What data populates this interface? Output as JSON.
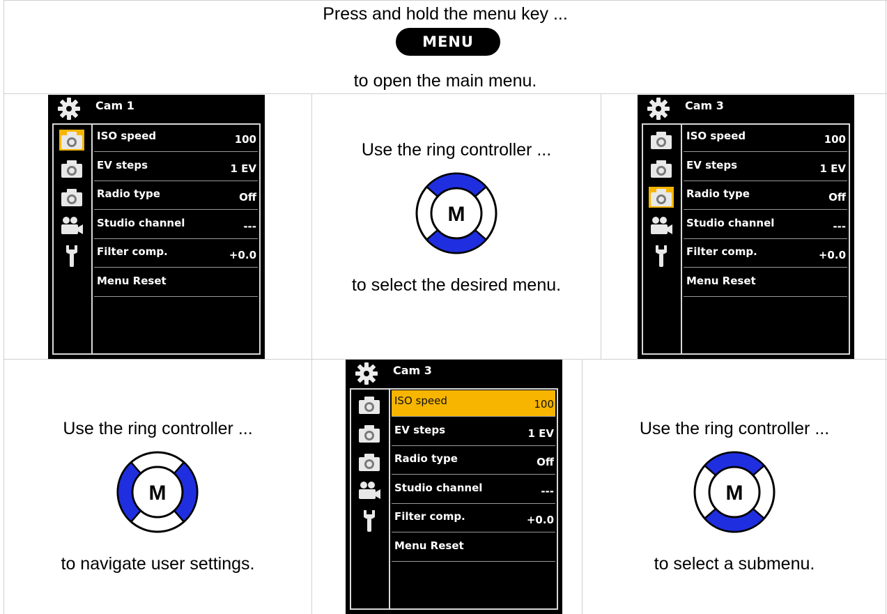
{
  "top": {
    "line1": "Press and hold the menu key ...",
    "key_label": "MENU",
    "line2": "to open the main menu."
  },
  "mid_center": {
    "line1": "Use the ring controller ...",
    "ring_letter": "M",
    "line2": "to select the desired menu."
  },
  "bottom_left": {
    "line1": "Use the ring controller ...",
    "ring_letter": "M",
    "line2": "to navigate user settings."
  },
  "bottom_right": {
    "line1": "Use the ring controller ...",
    "ring_letter": "M",
    "line2": "to select a submenu."
  },
  "screens": [
    {
      "title": "Cam 1",
      "selected_side": 0,
      "selected_row": -1,
      "rows": [
        {
          "label": "ISO speed",
          "value": "100"
        },
        {
          "label": "EV steps",
          "value": "1 EV"
        },
        {
          "label": "Radio type",
          "value": "Off"
        },
        {
          "label": "Studio channel",
          "value": "---"
        },
        {
          "label": "Filter comp.",
          "value": "+0.0"
        },
        {
          "label": "Menu Reset",
          "value": ""
        }
      ]
    },
    {
      "title": "Cam 3",
      "selected_side": 2,
      "selected_row": -1,
      "rows": [
        {
          "label": "ISO speed",
          "value": "100"
        },
        {
          "label": "EV steps",
          "value": "1 EV"
        },
        {
          "label": "Radio type",
          "value": "Off"
        },
        {
          "label": "Studio channel",
          "value": "---"
        },
        {
          "label": "Filter comp.",
          "value": "+0.0"
        },
        {
          "label": "Menu Reset",
          "value": ""
        }
      ]
    },
    {
      "title": "Cam 3",
      "selected_side": -1,
      "selected_row": 0,
      "rows": [
        {
          "label": "ISO speed",
          "value": "100"
        },
        {
          "label": "EV steps",
          "value": "1 EV"
        },
        {
          "label": "Radio type",
          "value": "Off"
        },
        {
          "label": "Studio channel",
          "value": "---"
        },
        {
          "label": "Filter comp.",
          "value": "+0.0"
        },
        {
          "label": "Menu Reset",
          "value": ""
        }
      ]
    }
  ],
  "colors": {
    "ring_active": "#1f2fe0",
    "highlight": "#f7b500",
    "screen_bg": "#000000",
    "grid": "#d0d0d0"
  },
  "icons": [
    "gear-icon",
    "camera-icon",
    "camera-icon",
    "camera-icon",
    "video-camera-icon",
    "wrench-icon"
  ]
}
